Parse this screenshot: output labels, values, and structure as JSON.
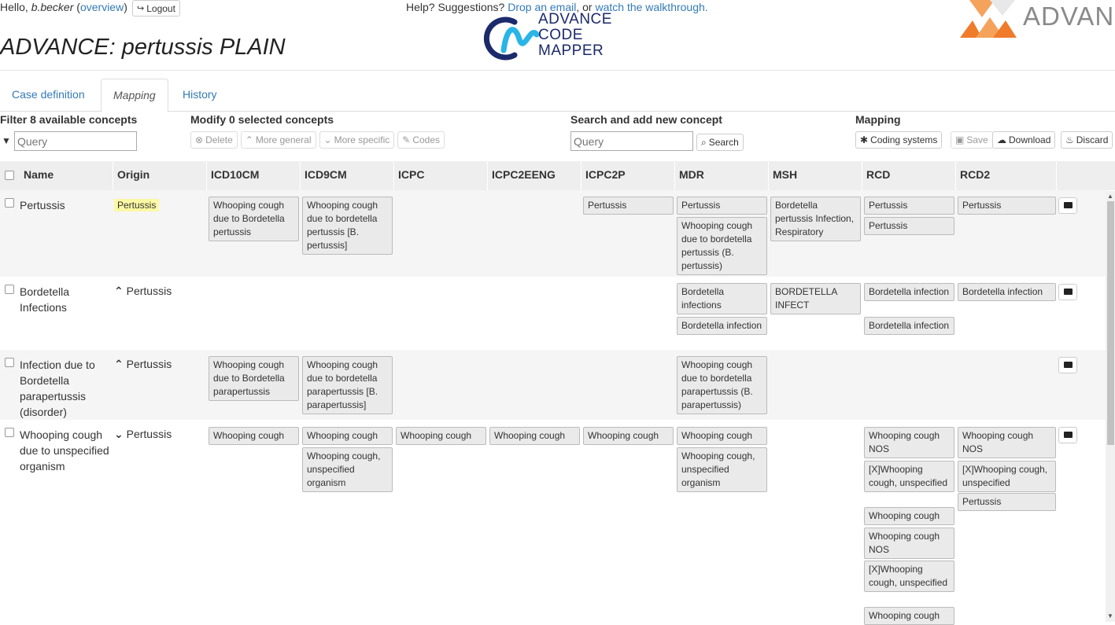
{
  "header": {
    "greeting": "Hello,",
    "username": "b.becker",
    "overview_link": "overview",
    "logout_label": "Logout",
    "help_text": "Help? Suggestions?",
    "email_link": "Drop an email",
    "or_text": ", or",
    "walkthrough_link": "watch the walkthrough.",
    "page_title": "ADVANCE: pertussis PLAIN",
    "cm_logo_lines": [
      "ADVANCE",
      "CODE",
      "MAPPER"
    ],
    "advance_logo_text": "ADVANCE"
  },
  "tabs": [
    "Case definition",
    "Mapping",
    "History"
  ],
  "toolbar": {
    "filter_title": "Filter 8 available concepts",
    "filter_placeholder": "Query",
    "modify_title": "Modify 0 selected concepts",
    "delete_label": "Delete",
    "more_general_label": "More general",
    "more_specific_label": "More specific",
    "codes_label": "Codes",
    "search_title": "Search and add new concept",
    "search_placeholder": "Query",
    "search_button": "Search",
    "mapping_title": "Mapping",
    "coding_systems_label": "Coding systems",
    "save_label": "Save",
    "download_label": "Download",
    "discard_label": "Discard"
  },
  "columns": [
    "Name",
    "Origin",
    "ICD10CM",
    "ICD9CM",
    "ICPC",
    "ICPC2EENG",
    "ICPC2P",
    "MDR",
    "MSH",
    "RCD",
    "RCD2"
  ],
  "rows": [
    {
      "name": "Pertussis",
      "origin": "Pertussis",
      "origin_icon": "",
      "codes": {
        "ICD10CM": [
          "Whooping cough due to Bordetella pertussis"
        ],
        "ICD9CM": [
          "Whooping cough due to bordetella pertussis [B. pertussis]"
        ],
        "ICPC2P": [
          "Pertussis"
        ],
        "MDR": [
          "Pertussis",
          "Whooping cough due to bordetella pertussis (B. pertussis)"
        ],
        "MSH": [
          "Bordetella pertussis Infection, Respiratory"
        ],
        "RCD": [
          "Pertussis",
          "Pertussis"
        ],
        "RCD2": [
          "Pertussis"
        ]
      }
    },
    {
      "name": "Bordetella Infections",
      "origin": "Pertussis",
      "origin_icon": "chevron-up-icon",
      "codes": {
        "MDR": [
          "Bordetella infections",
          "Bordetella infection"
        ],
        "MSH": [
          "BORDETELLA INFECT"
        ],
        "RCD": [
          "Bordetella infection",
          "Bordetella infection"
        ],
        "RCD2": [
          "Bordetella infection"
        ]
      }
    },
    {
      "name": "Infection due to Bordetella parapertussis (disorder)",
      "origin": "Pertussis",
      "origin_icon": "chevron-up-icon",
      "codes": {
        "ICD10CM": [
          "Whooping cough due to Bordetella parapertussis"
        ],
        "ICD9CM": [
          "Whooping cough due to bordetella parapertussis [B. parapertussis]"
        ],
        "MDR": [
          "Whooping cough due to bordetella parapertussis (B. parapertussis)"
        ]
      }
    },
    {
      "name": "Whooping cough due to unspecified organism",
      "origin": "Pertussis",
      "origin_icon": "chevron-down-icon",
      "codes": {
        "ICD10CM": [
          "Whooping cough"
        ],
        "ICD9CM": [
          "Whooping cough",
          "Whooping cough, unspecified organism"
        ],
        "ICPC": [
          "Whooping cough"
        ],
        "ICPC2EENG": [
          "Whooping cough"
        ],
        "ICPC2P": [
          "Whooping cough"
        ],
        "MDR": [
          "Whooping cough",
          "Whooping cough, unspecified organism"
        ],
        "RCD": [
          "Whooping cough NOS",
          "[X]Whooping cough, unspecified",
          "Whooping cough",
          "Whooping cough NOS",
          "[X]Whooping cough, unspecified",
          "Whooping cough"
        ],
        "RCD2": [
          "Whooping cough NOS",
          "[X]Whooping cough, unspecified",
          "Pertussis"
        ]
      }
    }
  ],
  "colors": {
    "link": "#337ab7",
    "header_bg": "#eeeeee",
    "row_shade": "#f5f5f5",
    "origin_highlight": "#fcf8a3",
    "code_bg": "#eaeaea",
    "logo_blue": "#1b2a6b",
    "logo_cyan": "#2ab5e6",
    "advance_orange": "#f07b2b"
  }
}
